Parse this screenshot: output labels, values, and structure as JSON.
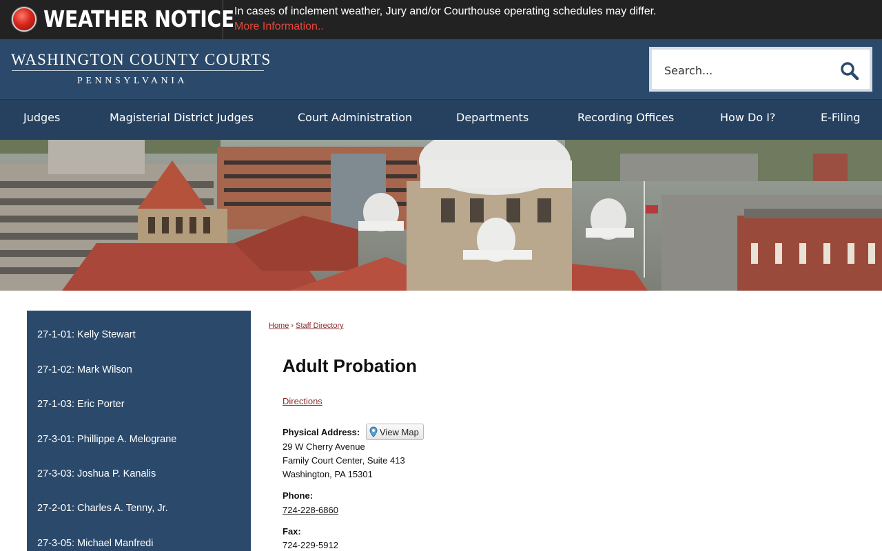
{
  "notice": {
    "title": "WEATHER NOTICE",
    "message": "In cases of inclement weather, Jury and/or Courthouse operating schedules may differ.",
    "link": "More Information.."
  },
  "header": {
    "logo_main": "WASHINGTON COUNTY COURTS",
    "logo_sub": "PENNSYLVANIA",
    "search_placeholder": "Search..."
  },
  "nav": {
    "items": [
      {
        "label": "Judges"
      },
      {
        "label": "Magisterial District Judges"
      },
      {
        "label": "Court Administration"
      },
      {
        "label": "Departments"
      },
      {
        "label": "Recording Offices"
      },
      {
        "label": "How Do I?"
      },
      {
        "label": "E-Filing"
      }
    ]
  },
  "sidebar": {
    "items": [
      {
        "label": "27-1-01: Kelly Stewart"
      },
      {
        "label": "27-1-02: Mark Wilson"
      },
      {
        "label": "27-1-03: Eric Porter"
      },
      {
        "label": "27-3-01: Phillippe A. Melograne"
      },
      {
        "label": "27-3-03: Joshua P. Kanalis"
      },
      {
        "label": "27-2-01: Charles A. Tenny, Jr."
      },
      {
        "label": "27-3-05: Michael Manfredi"
      }
    ]
  },
  "breadcrumb": {
    "home": "Home",
    "separator": "›",
    "current": "Staff Directory"
  },
  "content": {
    "title": "Adult Probation",
    "directions": "Directions",
    "physical_address_label": "Physical Address:",
    "view_map": "View Map",
    "address_line1": "29 W Cherry Avenue",
    "address_line2": "Family Court Center, Suite 413",
    "address_line3": "Washington, PA 15301",
    "phone_label": "Phone:",
    "phone": "724-228-6860",
    "fax_label": "Fax:",
    "fax": "724-229-5912"
  },
  "colors": {
    "header_bg": "#2b4a6b",
    "nav_bg": "#26415f",
    "notice_bg": "#222222",
    "notice_link": "#e8473a",
    "link": "#8b2c2c"
  }
}
